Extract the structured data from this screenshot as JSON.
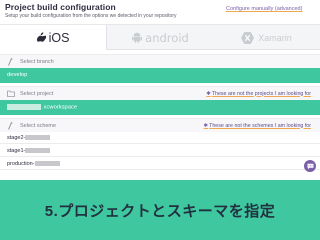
{
  "header": {
    "title": "Project build configuration",
    "subtitle": "Setup your build configuration from the options we detected in your repository",
    "configure_link": "Configure manually (advanced)"
  },
  "platform_tabs": [
    {
      "label": "iOS",
      "icon": "apple-icon",
      "selected": true
    },
    {
      "label": "android",
      "icon": "android-icon",
      "selected": false
    },
    {
      "label": "Xamarin",
      "icon": "xamarin-icon",
      "selected": false
    }
  ],
  "branch": {
    "heading": "Select branch",
    "selected": "develop"
  },
  "project": {
    "heading": "Select project",
    "not_looking_link": "These are not the projects I am looking for",
    "selected_suffix": ".xcworkspace"
  },
  "scheme": {
    "heading": "Select scheme",
    "not_looking_link": "These are not the schemes I am looking for",
    "items": [
      {
        "prefix": "stage2-"
      },
      {
        "prefix": "stage1-"
      },
      {
        "prefix": "production-"
      }
    ]
  },
  "caption": "5.プロジェクトとスキーマを指定",
  "colors": {
    "accent_green": "#3fc7a0",
    "brand_purple": "#7a5fa8",
    "link_underline": "#f0a850"
  }
}
